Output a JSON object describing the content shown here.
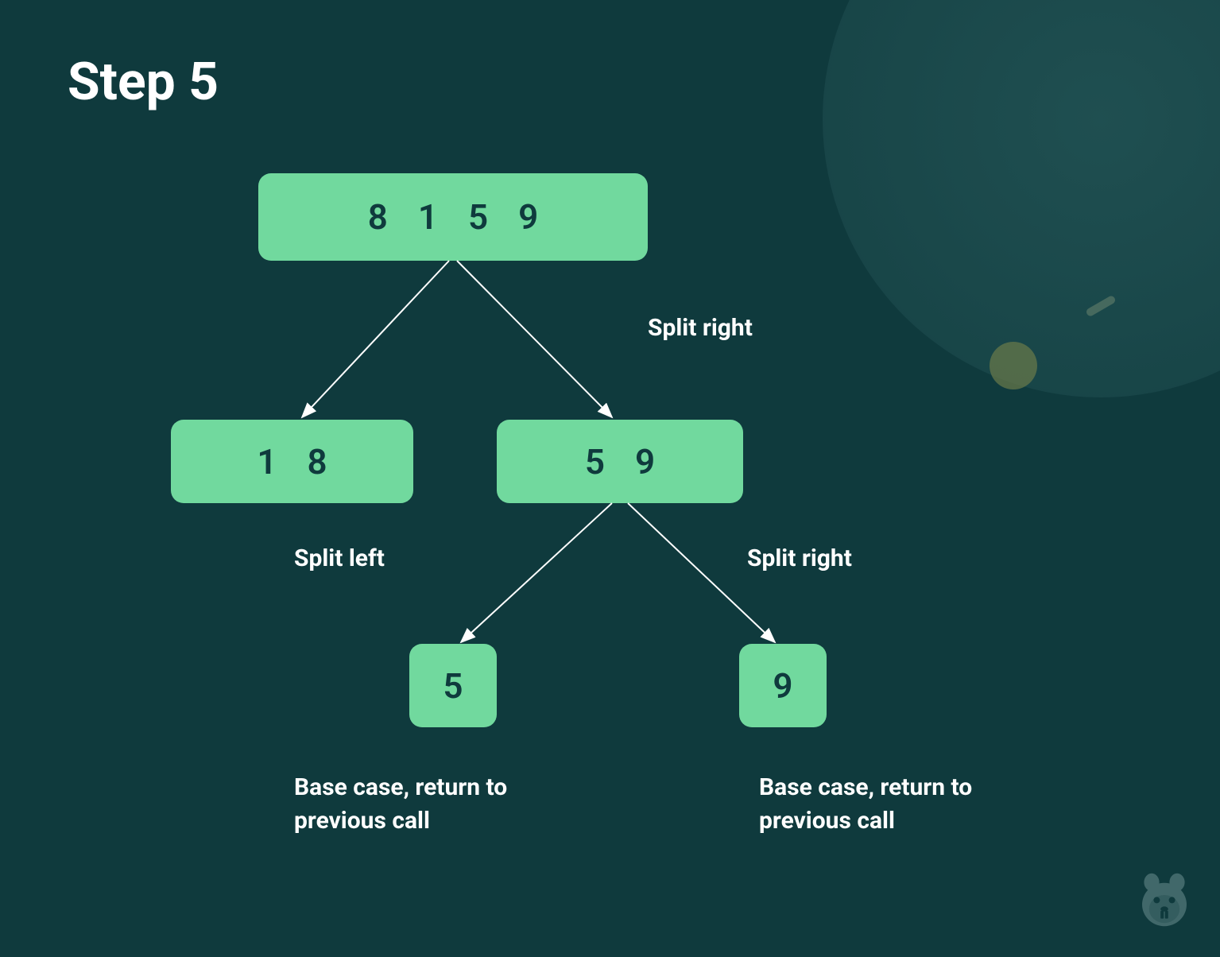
{
  "title": "Step 5",
  "root": {
    "values": [
      "8",
      "1",
      "5",
      "9"
    ]
  },
  "left_child": {
    "values": [
      "1",
      "8"
    ]
  },
  "right_child": {
    "values": [
      "5",
      "9"
    ]
  },
  "leaf_left": {
    "value": "5"
  },
  "leaf_right": {
    "value": "9"
  },
  "labels": {
    "split_right_1": "Split right",
    "split_left": "Split left",
    "split_right_2": "Split right"
  },
  "captions": {
    "base_left": "Base case, return to previous call",
    "base_right": "Base case, return to previous call"
  }
}
